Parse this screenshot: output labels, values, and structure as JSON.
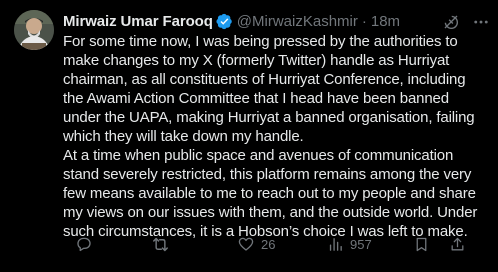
{
  "author": {
    "display_name": "Mirwaiz Umar Farooq",
    "handle": "@MirwaizKashmir",
    "separator": "·",
    "time": "18m",
    "verified": true,
    "verified_color": "#1d9bf0"
  },
  "tweet": {
    "lines": [
      "For some time now, I was being pressed by the authorities to",
      "make changes to my X (formerly Twitter) handle as Hurriyat",
      "chairman, as all constituents of Hurriyat Conference, including",
      "the Awami Action Committee that I head have been banned",
      "under the UAPA, making Hurriyat a banned organisation, failing",
      "which they will take down my handle.",
      "At a time when public space and avenues of communication",
      "stand severely restricted, this platform remains among the very",
      "few means available to me to reach out to my people and share",
      "my views on our issues with them, and the outside world. Under",
      "such circumstances, it is a Hobson’s choice I was left to make."
    ]
  },
  "actions": {
    "reply_count": "",
    "retweet_count": "",
    "like_count": "26",
    "view_count": "957"
  },
  "icons": {
    "header": [
      "grok-icon",
      "more-icon"
    ],
    "footer": [
      "reply-icon",
      "retweet-icon",
      "like-icon",
      "views-icon",
      "bookmark-icon",
      "share-icon"
    ]
  },
  "colors": {
    "background": "#000000",
    "text_primary": "#e7e9ea",
    "text_secondary": "#71767b",
    "verified_badge": "#1d9bf0"
  }
}
